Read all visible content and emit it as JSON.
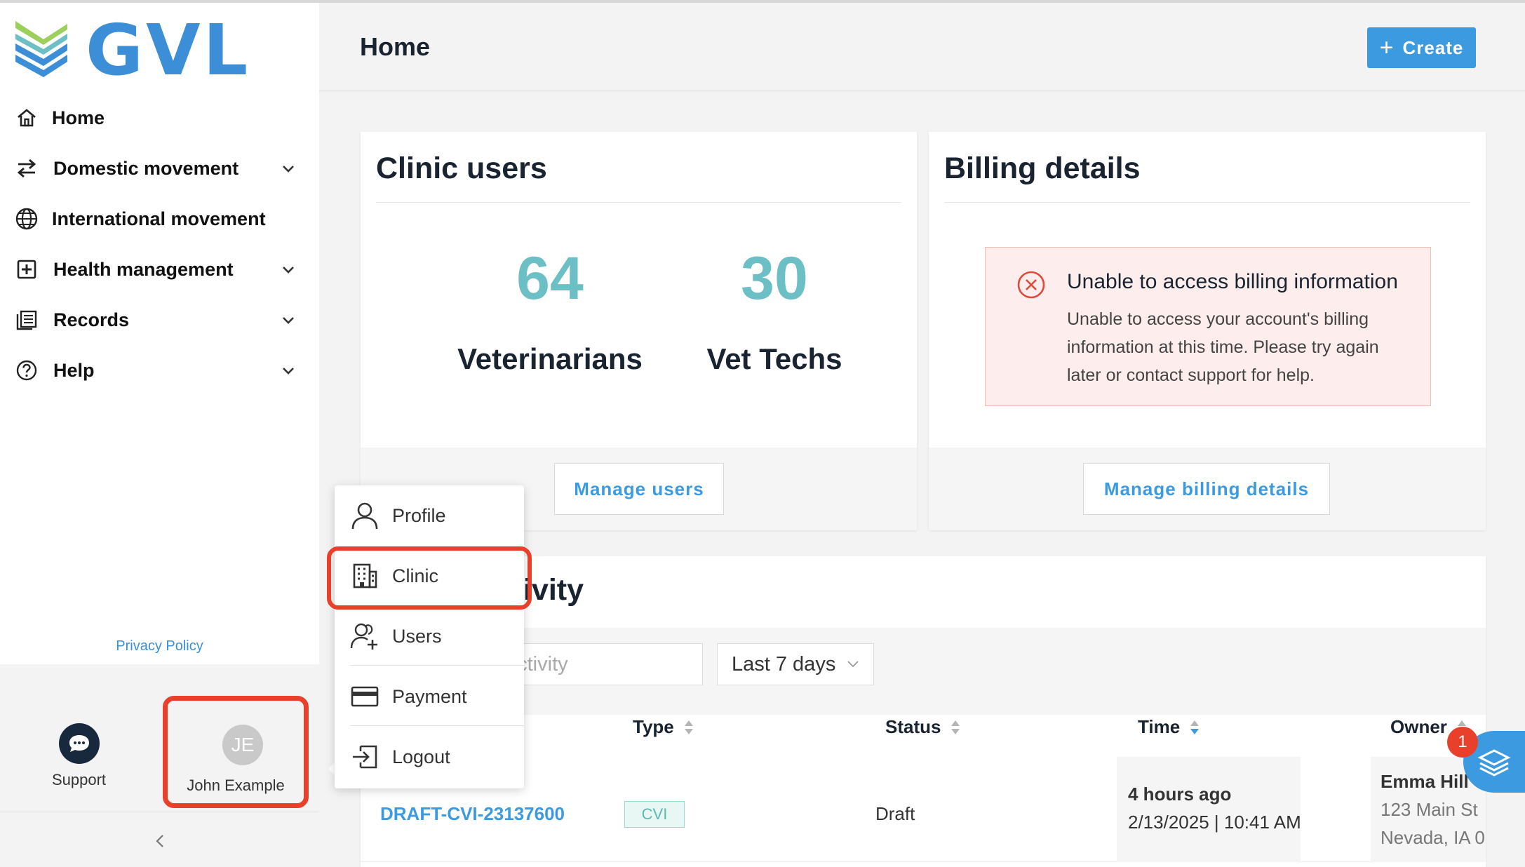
{
  "app": {
    "logo_text": "GVL"
  },
  "sidebar": {
    "items": [
      {
        "label": "Home",
        "icon": "home-icon",
        "expandable": false
      },
      {
        "label": "Domestic movement",
        "icon": "arrows-swap-icon",
        "expandable": true
      },
      {
        "label": "International movement",
        "icon": "globe-icon",
        "expandable": false
      },
      {
        "label": "Health management",
        "icon": "medical-plus-icon",
        "expandable": true
      },
      {
        "label": "Records",
        "icon": "records-icon",
        "expandable": true
      },
      {
        "label": "Help",
        "icon": "help-circle-icon",
        "expandable": true
      }
    ],
    "privacy_policy": "Privacy Policy",
    "support_label": "Support",
    "user": {
      "initials": "JE",
      "name": "John Example"
    }
  },
  "header": {
    "title": "Home",
    "create_label": "Create"
  },
  "clinic_users": {
    "title": "Clinic users",
    "stats": [
      {
        "value": "64",
        "label": "Veterinarians"
      },
      {
        "value": "30",
        "label": "Vet Techs"
      }
    ],
    "button": "Manage users"
  },
  "billing": {
    "title": "Billing details",
    "alert_title": "Unable to access billing information",
    "alert_body": "Unable to access your account's billing information at this time. Please try again later or contact support for help.",
    "button": "Manage billing details"
  },
  "activity": {
    "title_visible": "ivity",
    "search_placeholder_visible": "activity",
    "range": "Last 7 days",
    "columns": [
      "Type",
      "Status",
      "Time",
      "Owner"
    ],
    "rows": [
      {
        "id": "DRAFT-CVI-23137600",
        "type": "CVI",
        "status": "Draft",
        "time_relative": "4 hours ago",
        "time_abs": "2/13/2025 | 10:41 AM",
        "owner_name": "Emma Hill",
        "owner_addr1": "123 Main St",
        "owner_addr2": "Nevada, IA 0"
      }
    ]
  },
  "user_menu": {
    "items": [
      {
        "label": "Profile",
        "icon": "person-icon"
      },
      {
        "label": "Clinic",
        "icon": "building-icon"
      },
      {
        "label": "Users",
        "icon": "users-add-icon"
      },
      {
        "label": "Payment",
        "icon": "credit-card-icon"
      },
      {
        "label": "Logout",
        "icon": "logout-icon"
      }
    ]
  },
  "widget": {
    "badge_count": "1"
  },
  "colors": {
    "accent": "#3c9be0",
    "stat": "#6cc0c5",
    "highlight": "#e8402a",
    "alert_bg": "#fdeeed"
  }
}
